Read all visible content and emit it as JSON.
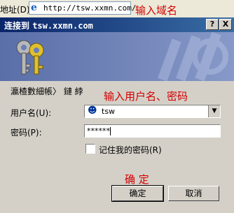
{
  "address_bar": {
    "label": "地址(D)",
    "url": "http://tsw.xxmn.com/",
    "annotation": "输入域名"
  },
  "dialog": {
    "title_prefix": "连接到",
    "title_host": "tsw.xxmn.com",
    "help_button": "?",
    "close_button": "X",
    "realm_text": "瀛楂數細帳〉 鏈 綍",
    "annotation_credentials": "输入用户名、密码",
    "username_label": "用户名(U):",
    "username_value": "tsw",
    "password_label": "密码(P):",
    "password_value": "******",
    "remember_label": "记住我的密码(R)",
    "annotation_ok": "确 定",
    "ok_button": "确定",
    "cancel_button": "取消"
  }
}
